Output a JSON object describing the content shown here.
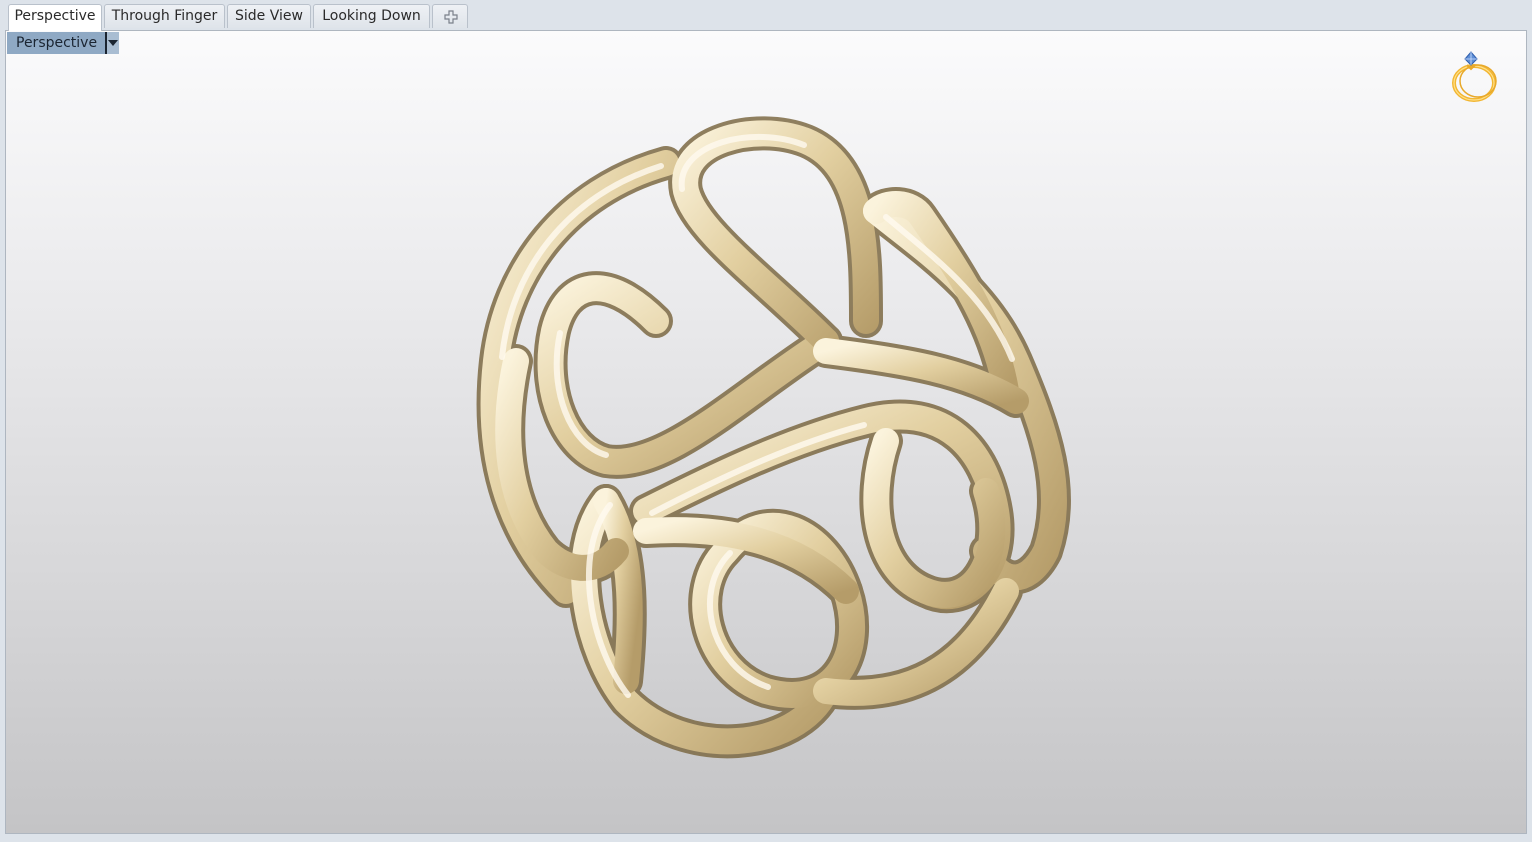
{
  "tabs": [
    {
      "label": "Perspective",
      "active": true
    },
    {
      "label": "Through Finger",
      "active": false
    },
    {
      "label": "Side View",
      "active": false
    },
    {
      "label": "Looking Down",
      "active": false
    }
  ],
  "add_tab_icon": "plus-icon",
  "viewport": {
    "label": "Perspective",
    "dropdown_icon": "triangle-down-icon",
    "corner_icon": "ring-icon"
  },
  "colors": {
    "gold": "#e2cfa0",
    "gold_dark": "#7d6a44",
    "gold_light": "#fbf3dc",
    "viewport_label_bg": "#8fa9c4"
  }
}
